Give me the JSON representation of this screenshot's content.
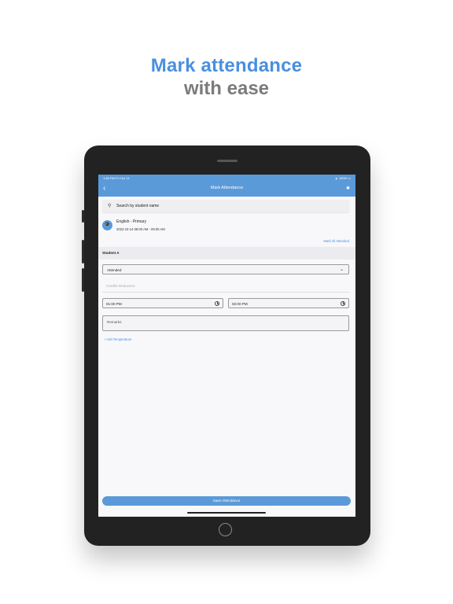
{
  "promo": {
    "line1": "Mark attendance",
    "line2": "with ease"
  },
  "status_bar": {
    "left": "1:56 PM   Fri Oct 14",
    "right": "▲ 100% ▭"
  },
  "nav": {
    "back_icon": "chevron-left-icon",
    "title": "Mark Attendance",
    "bluetooth_icon": "bluetooth-icon"
  },
  "search": {
    "placeholder": "Search by student name"
  },
  "course": {
    "name": "English - Primary",
    "time": "2022-10-14 08:00 AM - 09:00 AM"
  },
  "actions": {
    "mark_all": "Mark All Attended",
    "add_temperature": "+ Add Temperature",
    "save": "Save Attendance"
  },
  "student": {
    "name": "Student A",
    "attendance_status": "Attended",
    "credits_placeholder": "Credits Deduction",
    "start_time": "01:00 PM",
    "end_time": "02:00 PM",
    "remarks_placeholder": "Remarks"
  },
  "colors": {
    "accent": "#5b9ad8",
    "headline_blue": "#4a8fe0",
    "headline_gray": "#7b7b7b"
  }
}
